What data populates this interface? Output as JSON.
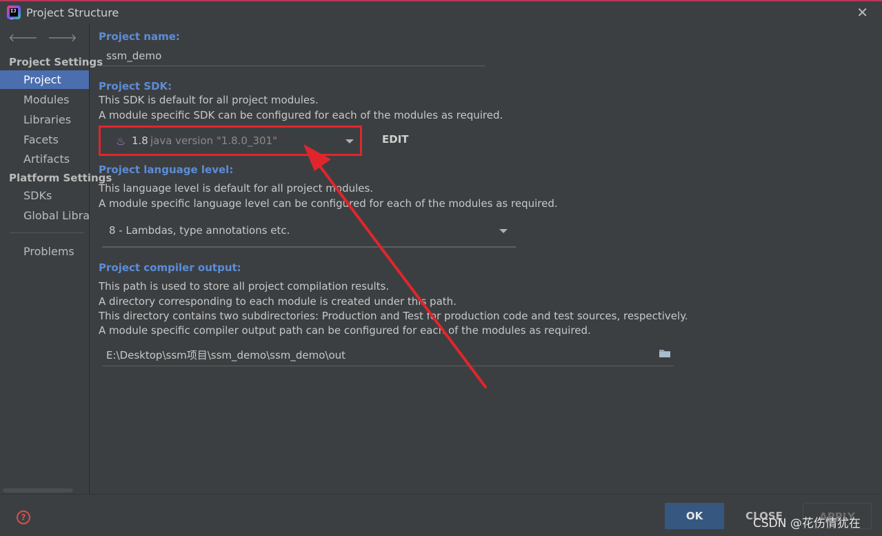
{
  "window": {
    "title": "Project Structure"
  },
  "sidebar": {
    "sections": [
      {
        "label": "Project Settings"
      },
      {
        "label": "Platform Settings"
      }
    ],
    "items": [
      {
        "label": "Project",
        "selected": true
      },
      {
        "label": "Modules"
      },
      {
        "label": "Libraries"
      },
      {
        "label": "Facets"
      },
      {
        "label": "Artifacts"
      },
      {
        "label": "SDKs"
      },
      {
        "label": "Global Libraries"
      },
      {
        "label": "Problems"
      }
    ]
  },
  "main": {
    "project_name": {
      "label": "Project name:",
      "value": "ssm_demo"
    },
    "sdk": {
      "label": "Project SDK:",
      "desc1": "This SDK is default for all project modules.",
      "desc2": "A module specific SDK can be configured for each of the modules as required.",
      "version": "1.8",
      "detail": "java version \"1.8.0_301\"",
      "edit_label": "EDIT"
    },
    "language": {
      "label": "Project language level:",
      "desc1": "This language level is default for all project modules.",
      "desc2": "A module specific language level can be configured for each of the modules as required.",
      "value": "8 - Lambdas, type annotations etc."
    },
    "compiler": {
      "label": "Project compiler output:",
      "desc1": "This path is used to store all project compilation results.",
      "desc2": "A directory corresponding to each module is created under this path.",
      "desc3": "This directory contains two subdirectories: Production and Test for production code and test sources, respectively.",
      "desc4": "A module specific compiler output path can be configured for each of the modules as required.",
      "path": "E:\\Desktop\\ssm项目\\ssm_demo\\ssm_demo\\out"
    }
  },
  "buttons": {
    "ok": "OK",
    "close": "CLOSE",
    "apply": "APPLY"
  },
  "watermark": "CSDN @花伤情犹在",
  "colors": {
    "accent": "#4b6eaf",
    "label_blue": "#5b8dd8",
    "annotation_red": "#e0262c",
    "ok_button": "#365880"
  }
}
